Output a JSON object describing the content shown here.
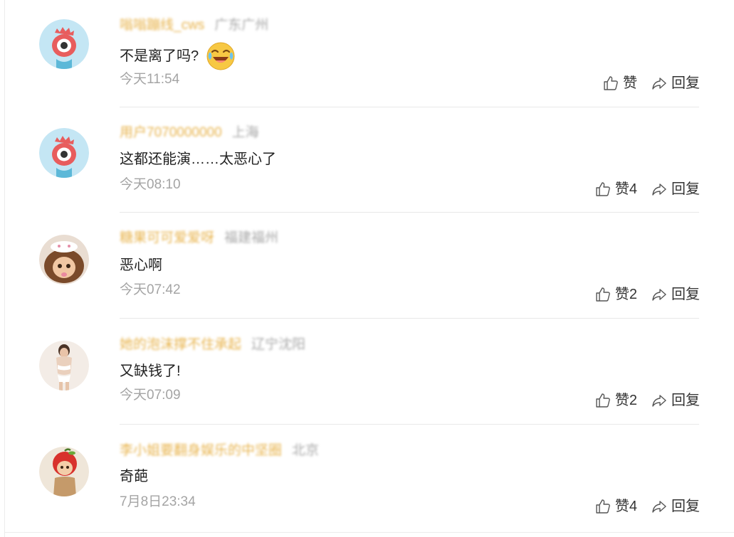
{
  "comments": [
    {
      "avatar": "default-eye-avatar",
      "username": "嗡嗡蹦线_cws",
      "location": "广东广州",
      "content": "不是离了吗?",
      "emoji": "laughing-crying-emoji",
      "time": "今天11:54",
      "like_label": "赞",
      "reply_label": "回复"
    },
    {
      "avatar": "default-eye-avatar",
      "username": "用户7070000000",
      "location": "上海",
      "content": "这都还能演……太恶心了",
      "time": "今天08:10",
      "like_label": "赞4",
      "reply_label": "回复"
    },
    {
      "avatar": "doll-avatar",
      "username": "糖果可可爱爱呀",
      "location": "福建福州",
      "content": "恶心啊",
      "time": "今天07:42",
      "like_label": "赞2",
      "reply_label": "回复"
    },
    {
      "avatar": "photo-avatar",
      "username": "她的泡沫撑不住承起",
      "location": "辽宁沈阳",
      "content": "又缺钱了!",
      "time": "今天07:09",
      "like_label": "赞2",
      "reply_label": "回复"
    },
    {
      "avatar": "apple-doll-avatar",
      "username": "李小姐要翻身娱乐的中坚圈",
      "location": "北京",
      "content": "奇葩",
      "time": "7月8日23:34",
      "like_label": "赞4",
      "reply_label": "回复"
    }
  ],
  "colors": {
    "username": "#e8b44e",
    "location": "#a8a8a8",
    "time": "#a4a4a4",
    "content": "#222222",
    "divider": "#e8e8e8",
    "avatar_bg": "#bfe4f3",
    "avatar_eye": "#e85d5d"
  }
}
